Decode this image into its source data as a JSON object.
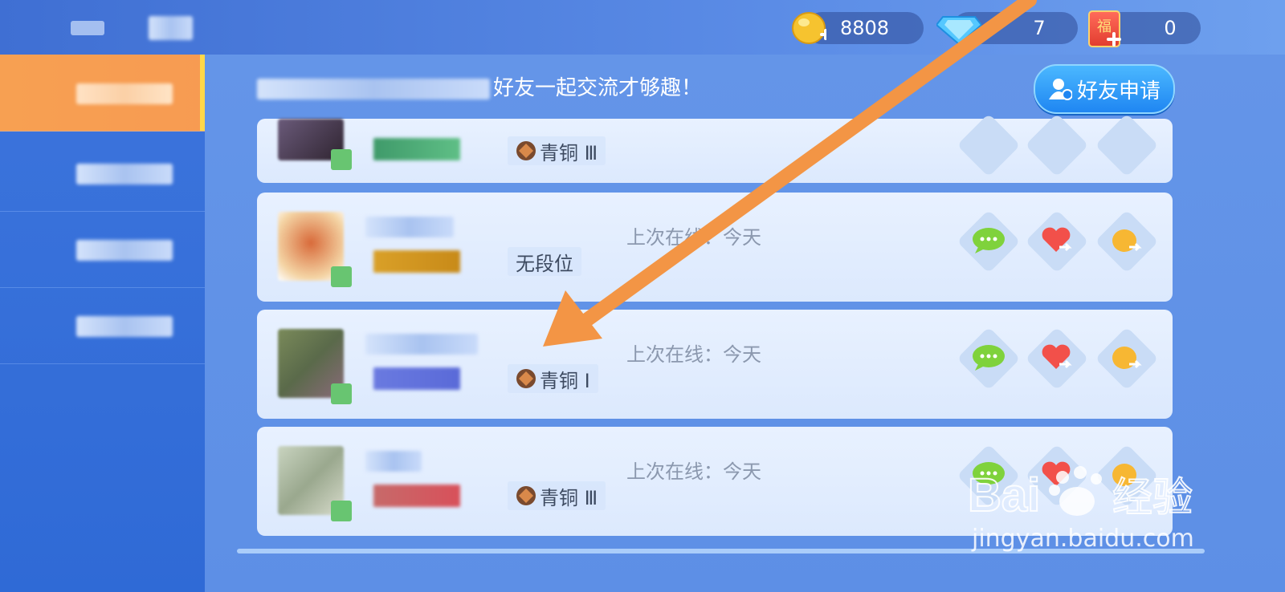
{
  "resources": {
    "gold": {
      "value": "8808",
      "icon": "gold-bean-add-icon"
    },
    "diamond": {
      "value": "7",
      "icon": "diamond-icon"
    },
    "fu": {
      "value": "0",
      "icon": "fu-card-add-icon",
      "glyph": "福"
    }
  },
  "hint": {
    "text": "好友一起交流才够趣！"
  },
  "friend_request": {
    "label": "好友申请",
    "icon": "add-friend-icon"
  },
  "friends": [
    {
      "rank": "青铜 Ⅲ",
      "last_online": "",
      "rank_icon": "bronze-rank-icon"
    },
    {
      "rank": "无段位",
      "last_online": "上次在线：今天",
      "rank_icon": ""
    },
    {
      "rank": "青铜 Ⅰ",
      "last_online": "上次在线：今天",
      "rank_icon": "bronze-rank-icon"
    },
    {
      "rank": "青铜 Ⅲ",
      "last_online": "上次在线：今天",
      "rank_icon": "bronze-rank-icon"
    }
  ],
  "actions": [
    "chat-icon",
    "send-heart-icon",
    "send-gift-icon"
  ],
  "watermark": {
    "logo": "Bai du 经验",
    "url": "jingyan.baidu.com"
  },
  "colors": {
    "accent_orange": "#f39545",
    "active_tab": "#f7a052",
    "primary_blue": "#1f86f2"
  }
}
